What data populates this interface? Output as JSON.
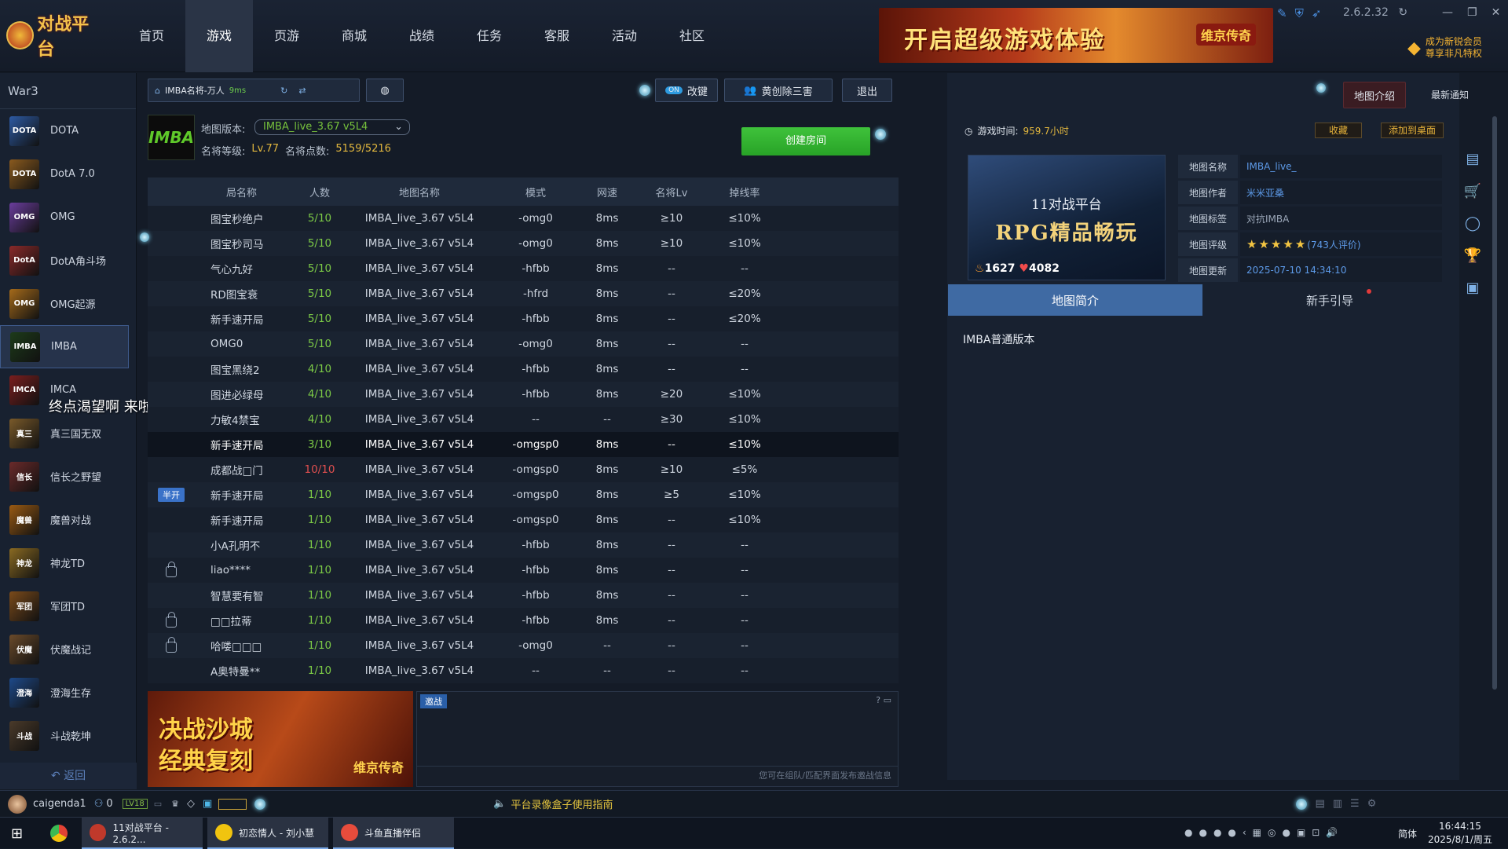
{
  "app": {
    "logo_text": "对战平台",
    "version": "2.6.2.32"
  },
  "nav": [
    "首页",
    "游戏",
    "页游",
    "商城",
    "战绩",
    "任务",
    "客服",
    "活动",
    "社区"
  ],
  "nav_active": 1,
  "banner": {
    "text": "开启超级游戏体验",
    "badge": "维京传奇"
  },
  "vip": {
    "line1": "成为新锐会员",
    "line2": "尊享非凡特权"
  },
  "sidebar": {
    "heading": "War3",
    "items": [
      {
        "label": "DOTA",
        "icon": "DOTA",
        "color": "#2d5aa3"
      },
      {
        "label": "DotA 7.0",
        "icon": "DOTA",
        "color": "#8a5a1e"
      },
      {
        "label": "OMG",
        "icon": "OMG",
        "color": "#6a3d9c"
      },
      {
        "label": "DotA角斗场",
        "icon": "DotA",
        "color": "#8a2a2a"
      },
      {
        "label": "OMG起源",
        "icon": "OMG",
        "color": "#a56a1a"
      },
      {
        "label": "IMBA",
        "icon": "IMBA",
        "color": "#1d3b1a"
      },
      {
        "label": "IMCA",
        "icon": "IMCA",
        "color": "#7a1e1e"
      },
      {
        "label": "真三国无双",
        "icon": "真三",
        "color": "#7a5a2a"
      },
      {
        "label": "信长之野望",
        "icon": "信长",
        "color": "#6a2a2a"
      },
      {
        "label": "魔兽对战",
        "icon": "魔兽",
        "color": "#9a5a12"
      },
      {
        "label": "神龙TD",
        "icon": "神龙",
        "color": "#8a6a22"
      },
      {
        "label": "军团TD",
        "icon": "军团",
        "color": "#7a4a1a"
      },
      {
        "label": "伏魔战记",
        "icon": "伏魔",
        "color": "#6a4a2a"
      },
      {
        "label": "澄海生存",
        "icon": "澄海",
        "color": "#1e4a8a"
      },
      {
        "label": "斗战乾坤",
        "icon": "斗战",
        "color": "#4a3a2a"
      }
    ],
    "active_index": 5,
    "back_label": "返回"
  },
  "overlay_text": "终点渴望啊   来啦",
  "toolbar": {
    "room_name": "IMBA名将-万人",
    "room_ping": "9ms",
    "auto_label": "改键",
    "auto_toggle": "ON",
    "helper_label": "黄创除三害",
    "exit_label": "退出"
  },
  "map_header": {
    "logo": "IMBA",
    "version_label": "地图版本:",
    "version_value": "IMBA_live_3.67 v5L4",
    "level_label": "名将等级:",
    "level_value": "Lv.77",
    "points_label": "名将点数:",
    "points_value": "5159/5216",
    "create_label": "创建房间"
  },
  "table": {
    "headers": [
      "局名称",
      "人数",
      "地图名称",
      "模式",
      "网速",
      "名将Lv",
      "掉线率"
    ],
    "rows": [
      {
        "tag": "",
        "name": "图宝秒绝户",
        "count": "5/10",
        "map": "IMBA_live_3.67 v5L4",
        "mode": "-omg0",
        "ping": "8ms",
        "lv": "≥10",
        "drop": "≤10%"
      },
      {
        "tag": "",
        "name": "图宝秒司马",
        "count": "5/10",
        "map": "IMBA_live_3.67 v5L4",
        "mode": "-omg0",
        "ping": "8ms",
        "lv": "≥10",
        "drop": "≤10%"
      },
      {
        "tag": "",
        "name": "气心九好",
        "count": "5/10",
        "map": "IMBA_live_3.67 v5L4",
        "mode": "-hfbb",
        "ping": "8ms",
        "lv": "--",
        "drop": "--"
      },
      {
        "tag": "",
        "name": "RD图宝衰",
        "count": "5/10",
        "map": "IMBA_live_3.67 v5L4",
        "mode": "-hfrd",
        "ping": "8ms",
        "lv": "--",
        "drop": "≤20%"
      },
      {
        "tag": "",
        "name": "新手速开局",
        "count": "5/10",
        "map": "IMBA_live_3.67 v5L4",
        "mode": "-hfbb",
        "ping": "8ms",
        "lv": "--",
        "drop": "≤20%"
      },
      {
        "tag": "",
        "name": "OMG0",
        "count": "5/10",
        "map": "IMBA_live_3.67 v5L4",
        "mode": "-omg0",
        "ping": "8ms",
        "lv": "--",
        "drop": "--"
      },
      {
        "tag": "",
        "name": "图宝黑绕2",
        "count": "4/10",
        "map": "IMBA_live_3.67 v5L4",
        "mode": "-hfbb",
        "ping": "8ms",
        "lv": "--",
        "drop": "--"
      },
      {
        "tag": "",
        "name": "图进必绿母",
        "count": "4/10",
        "map": "IMBA_live_3.67 v5L4",
        "mode": "-hfbb",
        "ping": "8ms",
        "lv": "≥20",
        "drop": "≤10%"
      },
      {
        "tag": "",
        "name": "力敏4禁宝",
        "count": "4/10",
        "map": "IMBA_live_3.67 v5L4",
        "mode": "--",
        "ping": "--",
        "lv": "≥30",
        "drop": "≤10%"
      },
      {
        "tag": "",
        "name": "新手速开局",
        "count": "3/10",
        "map": "IMBA_live_3.67 v5L4",
        "mode": "-omgsp0",
        "ping": "8ms",
        "lv": "--",
        "drop": "≤10%",
        "sel": true
      },
      {
        "tag": "",
        "name": "成都战□门",
        "count": "10/10",
        "map": "IMBA_live_3.67 v5L4",
        "mode": "-omgsp0",
        "ping": "8ms",
        "lv": "≥10",
        "drop": "≤5%",
        "full": true
      },
      {
        "tag": "半开",
        "name": "新手速开局",
        "count": "1/10",
        "map": "IMBA_live_3.67 v5L4",
        "mode": "-omgsp0",
        "ping": "8ms",
        "lv": "≥5",
        "drop": "≤10%"
      },
      {
        "tag": "",
        "name": "新手速开局",
        "count": "1/10",
        "map": "IMBA_live_3.67 v5L4",
        "mode": "-omgsp0",
        "ping": "8ms",
        "lv": "--",
        "drop": "≤10%"
      },
      {
        "tag": "",
        "name": "小A孔明不",
        "count": "1/10",
        "map": "IMBA_live_3.67 v5L4",
        "mode": "-hfbb",
        "ping": "8ms",
        "lv": "--",
        "drop": "--"
      },
      {
        "tag": "lock",
        "name": "liao****",
        "count": "1/10",
        "map": "IMBA_live_3.67 v5L4",
        "mode": "-hfbb",
        "ping": "8ms",
        "lv": "--",
        "drop": "--"
      },
      {
        "tag": "",
        "name": "智慧要有智",
        "count": "1/10",
        "map": "IMBA_live_3.67 v5L4",
        "mode": "-hfbb",
        "ping": "8ms",
        "lv": "--",
        "drop": "--"
      },
      {
        "tag": "lock",
        "name": "□□拉蒂",
        "count": "1/10",
        "map": "IMBA_live_3.67 v5L4",
        "mode": "-hfbb",
        "ping": "8ms",
        "lv": "--",
        "drop": "--"
      },
      {
        "tag": "lock",
        "name": "哈喽□□□",
        "count": "1/10",
        "map": "IMBA_live_3.67 v5L4",
        "mode": "-omg0",
        "ping": "--",
        "lv": "--",
        "drop": "--"
      },
      {
        "tag": "",
        "name": "A奥特曼**",
        "count": "1/10",
        "map": "IMBA_live_3.67 v5L4",
        "mode": "--",
        "ping": "--",
        "lv": "--",
        "drop": "--"
      }
    ]
  },
  "ad": {
    "line1": "决战沙城",
    "line2": "经典复刻",
    "badge": "维京传奇"
  },
  "chat": {
    "tab": "邀战",
    "hint": "您可在组队/匹配界面发布邀战信息",
    "icons": "?  ▭"
  },
  "right": {
    "tab_map": "地图介绍",
    "tab_notice": "最新通知",
    "play_time_label": "游戏时间:",
    "play_time_value": "959.7小时",
    "fav_label": "收藏",
    "desktop_label": "添加到桌面",
    "map_image_title": "11对战平台",
    "map_image_sub": "RPG精品畅玩",
    "map_image_hot": "1627",
    "map_image_likes": "4082",
    "info": [
      {
        "k": "地图名称",
        "v": "IMBA_live_"
      },
      {
        "k": "地图作者",
        "v": "米米亚桑"
      },
      {
        "k": "地图标签",
        "v": "对抗IMBA"
      },
      {
        "k": "地图评级",
        "v": "(743人评价)"
      },
      {
        "k": "地图更新",
        "v": "2025-07-10 14:34:10"
      }
    ],
    "rating_stars": 5,
    "tab_intro": "地图简介",
    "tab_guide": "新手引导",
    "intro_text": "IMBA普通版本"
  },
  "status": {
    "username": "caigenda1",
    "friends": "0",
    "lv": "LV18",
    "notice": "平台录像盒子使用指南"
  },
  "taskbar": {
    "items": [
      "11对战平台 - 2.6.2...",
      "初恋情人 - 刘小慧",
      "斗鱼直播伴侣"
    ],
    "lang": "简体",
    "time": "16:44:15",
    "date": "2025/8/1/周五"
  }
}
